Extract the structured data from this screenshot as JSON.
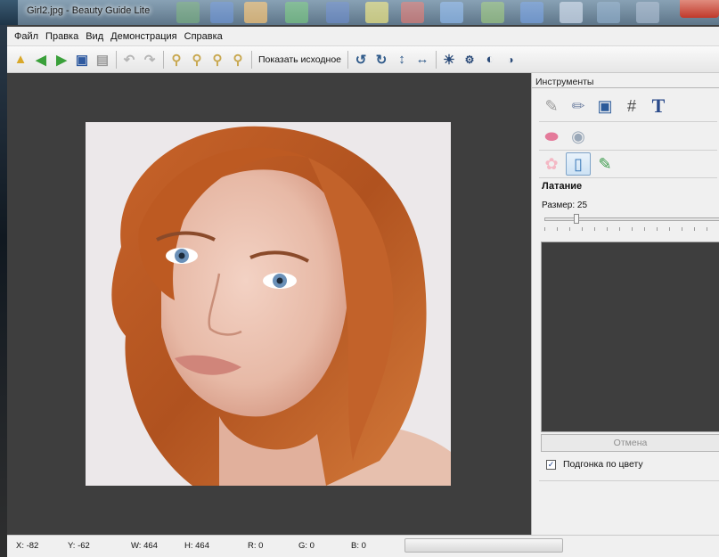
{
  "window": {
    "title": "Girl2.jpg - Beauty Guide Lite"
  },
  "menu": [
    "Файл",
    "Правка",
    "Вид",
    "Демонстрация",
    "Справка"
  ],
  "toolbar": {
    "show_original_label": "Показать исходное"
  },
  "panel": {
    "title": "Инструменты",
    "tool_name": "Латание",
    "size_label": "Размер: 25",
    "size_value": 25,
    "cancel_label": "Отмена",
    "fit_color_label": "Подгонка по цвету",
    "fit_color_checked": true
  },
  "status": {
    "x": "X: -82",
    "y": "Y: -62",
    "w": "W: 464",
    "h": "H: 464",
    "r": "R: 0",
    "g": "G: 0",
    "b": "B: 0"
  },
  "colors": {
    "canvas_bg": "#3e3e3e",
    "panel_bg": "#f0f0f0",
    "accent": "#4a90d9"
  }
}
